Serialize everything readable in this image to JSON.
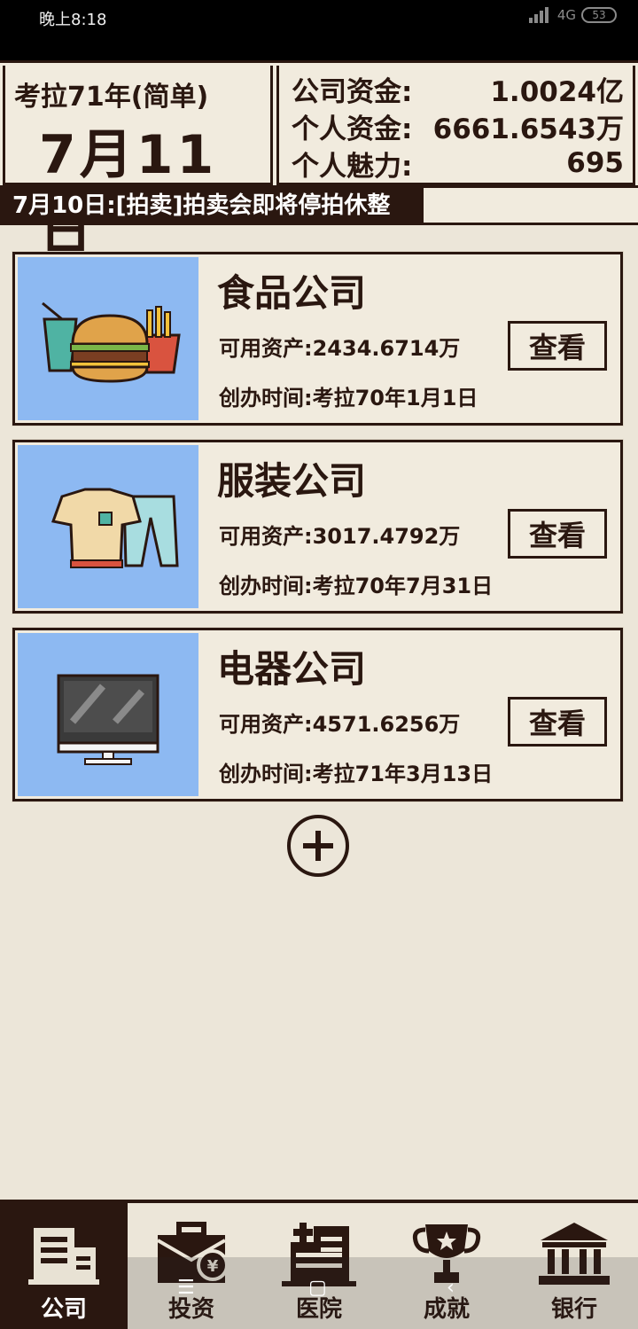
{
  "status_bar": {
    "time": "晚上8:18",
    "network": "4G",
    "battery": "53"
  },
  "header": {
    "year_label": "考拉71年(简单)",
    "date": "7月11日",
    "funds": [
      {
        "label": "公司资金:",
        "value": "1.0024亿"
      },
      {
        "label": "个人资金:",
        "value": "6661.6543万"
      },
      {
        "label": "个人魅力:",
        "value": "695"
      }
    ]
  },
  "ticker": {
    "text": "7月10日:[拍卖]拍卖会即将停拍休整"
  },
  "companies": [
    {
      "name": "食品公司",
      "assets": "可用资产:2434.6714万",
      "founded": "创办时间:考拉70年1月1日",
      "button": "查看",
      "icon": "food-icon"
    },
    {
      "name": "服装公司",
      "assets": "可用资产:3017.4792万",
      "founded": "创办时间:考拉70年7月31日",
      "button": "查看",
      "icon": "clothing-icon"
    },
    {
      "name": "电器公司",
      "assets": "可用资产:4571.6256万",
      "founded": "创办时间:考拉71年3月13日",
      "button": "查看",
      "icon": "monitor-icon"
    }
  ],
  "nav": [
    {
      "label": "公司",
      "icon": "company-icon",
      "active": true
    },
    {
      "label": "投资",
      "icon": "briefcase-icon",
      "active": false
    },
    {
      "label": "医院",
      "icon": "hospital-icon",
      "active": false
    },
    {
      "label": "成就",
      "icon": "trophy-icon",
      "active": false
    },
    {
      "label": "银行",
      "icon": "bank-icon",
      "active": false
    }
  ],
  "colors": {
    "background": "#ece6d9",
    "dark": "#2a1710",
    "card_icon_bg": "#8db9f2"
  }
}
